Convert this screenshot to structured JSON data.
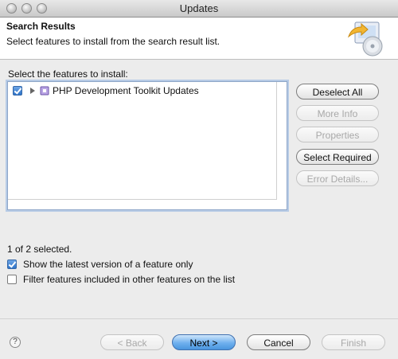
{
  "window": {
    "title": "Updates"
  },
  "header": {
    "title": "Search Results",
    "description": "Select features to install from the search result list."
  },
  "features": {
    "label": "Select the features to install:",
    "items": [
      {
        "label": "PHP Development Toolkit Updates",
        "checked": true,
        "expanded": false
      }
    ]
  },
  "side_buttons": {
    "deselect_all": "Deselect All",
    "more_info": "More Info",
    "properties": "Properties",
    "select_required": "Select Required",
    "error_details": "Error Details..."
  },
  "selection": {
    "count_text": "1 of 2 selected."
  },
  "options": {
    "latest_version": {
      "label": "Show the latest version of a feature only",
      "checked": true
    },
    "filter_included": {
      "label": "Filter features included in other features on the list",
      "checked": false
    }
  },
  "footer": {
    "help": "?",
    "back": "< Back",
    "next": "Next >",
    "cancel": "Cancel",
    "finish": "Finish"
  }
}
